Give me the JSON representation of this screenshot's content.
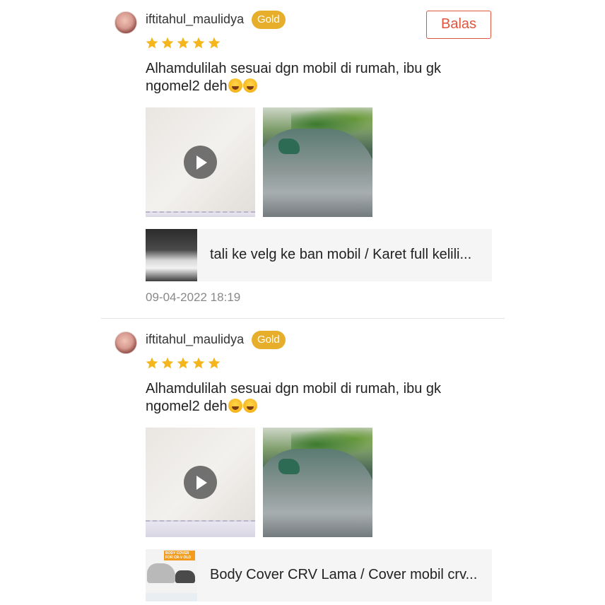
{
  "reviews": [
    {
      "username": "iftitahul_maulidya",
      "badge": "Gold",
      "reply_label": "Balas",
      "rating": 5,
      "comment_line1": "Alhamdulilah sesuai dgn mobil di rumah, ibu gk",
      "comment_line2": "ngomel2 deh",
      "emoji_icon": "rolling-on-floor-laughing-icon",
      "product_title": "tali ke velg ke ban mobil / Karet full kelili...",
      "timestamp": "09-04-2022 18:19"
    },
    {
      "username": "iftitahul_maulidya",
      "badge": "Gold",
      "rating": 5,
      "comment_line1": "Alhamdulilah sesuai dgn mobil di rumah, ibu gk",
      "comment_line2": "ngomel2 deh",
      "emoji_icon": "rolling-on-floor-laughing-icon",
      "product_title": "Body Cover CRV Lama / Cover mobil crv...",
      "thumb_label": "BODY COVER FOR CR-V OLD"
    }
  ],
  "colors": {
    "accent": "#e0553b",
    "badge": "#e6ae2a",
    "star": "#f5b51d",
    "muted_text": "#888888"
  }
}
